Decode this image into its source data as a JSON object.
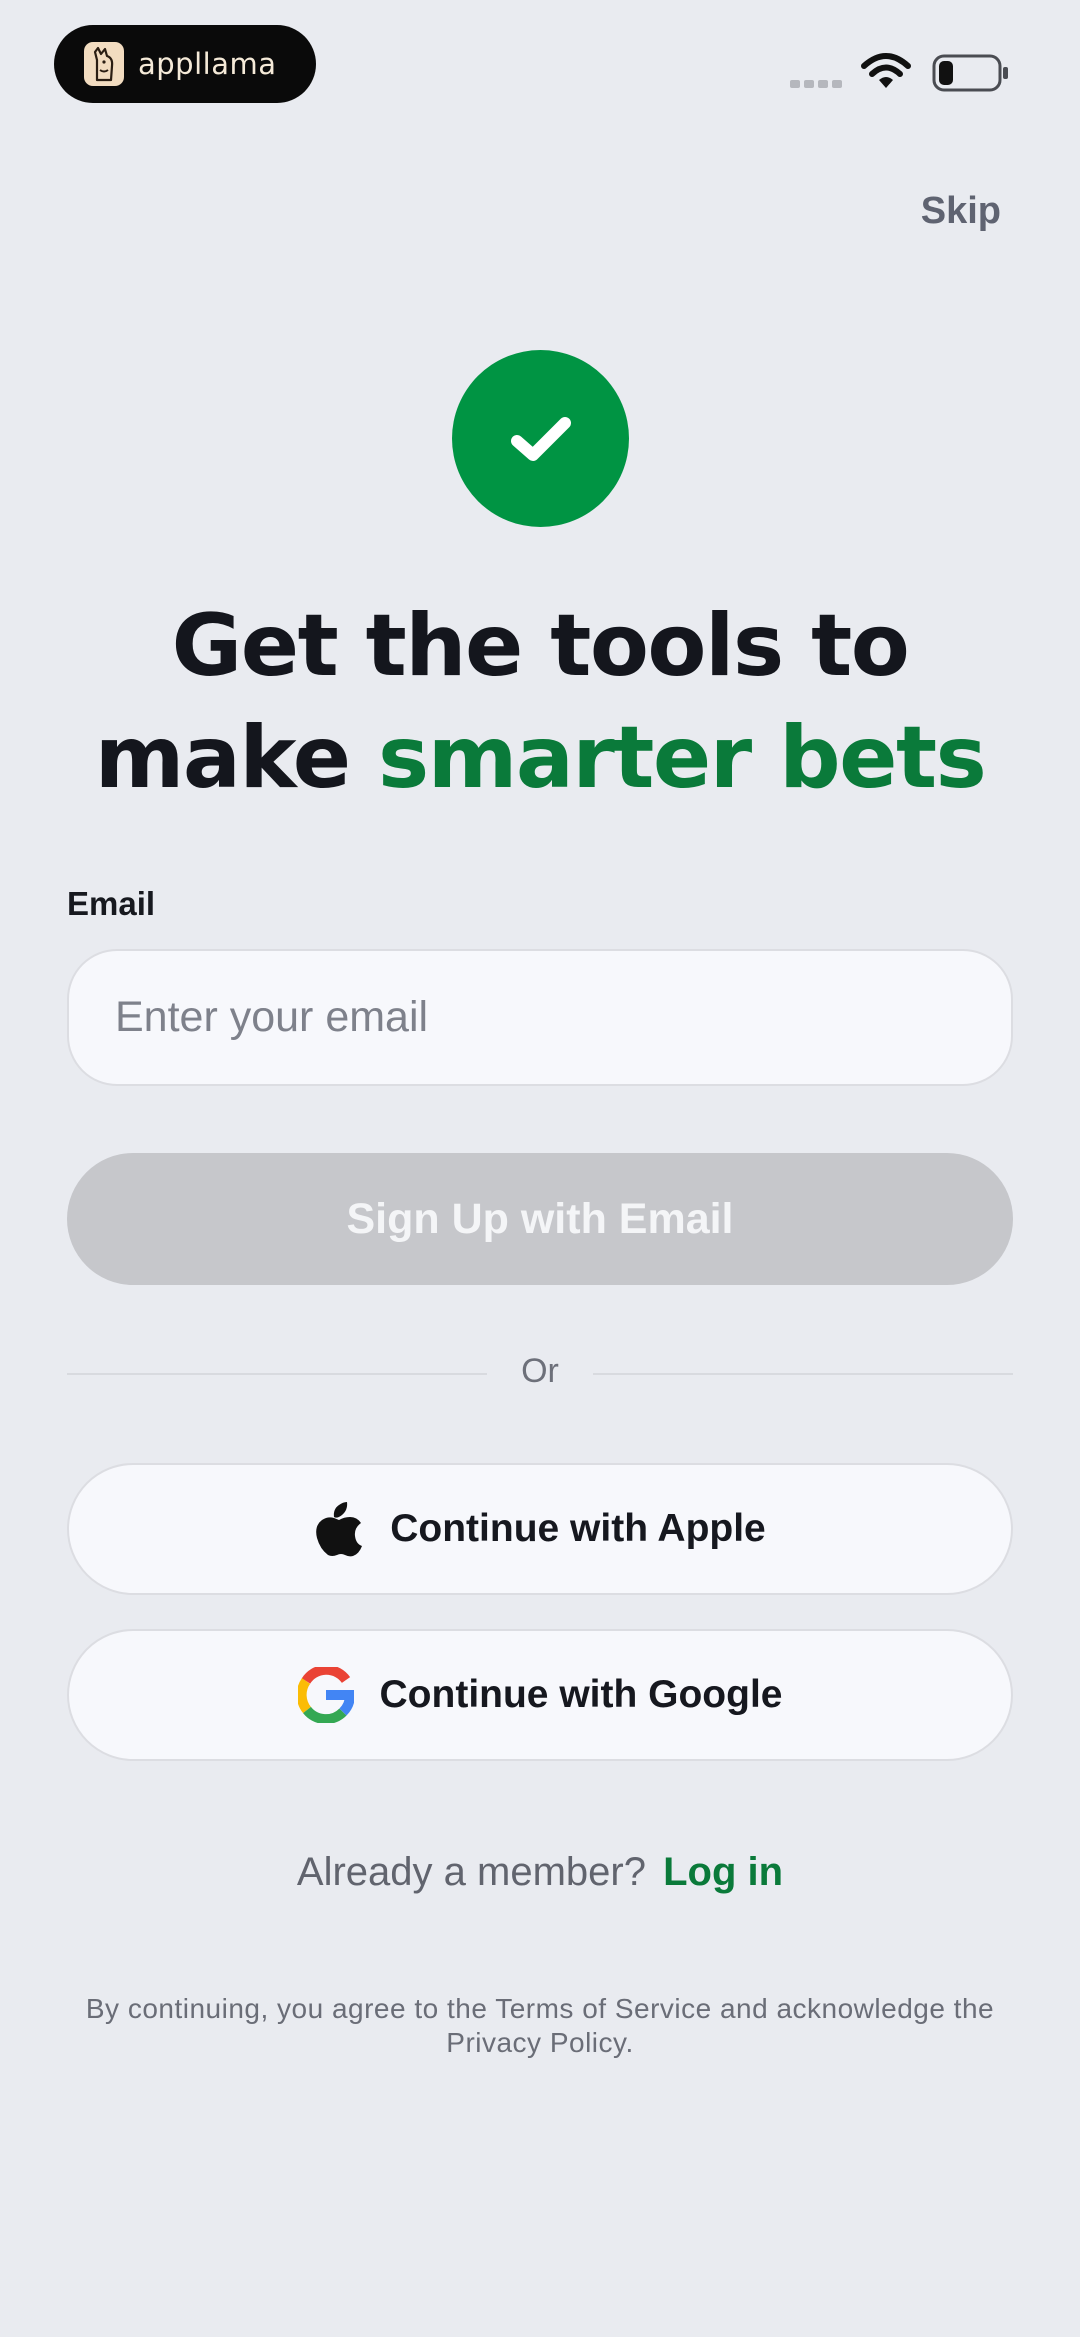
{
  "status_bar": {
    "brand_name": "appllama",
    "icons": [
      "signal-icon",
      "wifi-icon",
      "battery-icon"
    ]
  },
  "header": {
    "skip_label": "Skip"
  },
  "hero": {
    "icon": "checkmark-icon",
    "headline_line1": "Get the tools to",
    "headline_line2_plain": "make",
    "headline_line2_accent": "smarter bets"
  },
  "form": {
    "email_label": "Email",
    "email_placeholder": "Enter your email",
    "email_value": "",
    "signup_label": "Sign Up with Email"
  },
  "divider_label": "Or",
  "social": {
    "apple_label": "Continue with Apple",
    "google_label": "Continue with Google"
  },
  "footer": {
    "member_prompt": "Already a member?",
    "login_label": "Log in",
    "legal": "By continuing, you agree to the Terms of Service and acknowledge the Privacy Policy."
  },
  "colors": {
    "background": "#e9ebf0",
    "accent_green": "#0a7a3a",
    "check_green": "#009443",
    "disabled_button": "#c6c7cb"
  }
}
